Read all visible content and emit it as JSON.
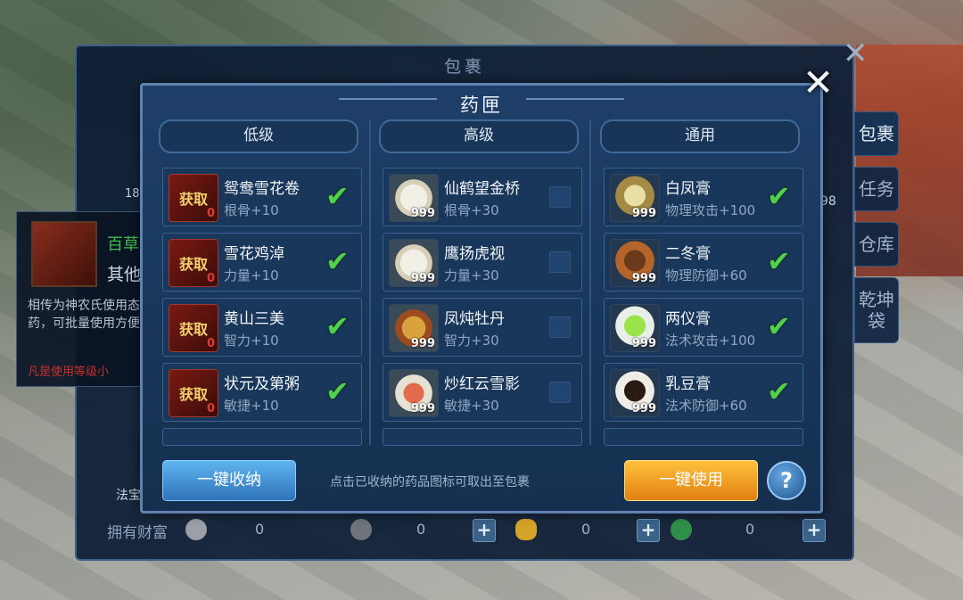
{
  "bag": {
    "title": "包裹",
    "side_tabs": [
      "包裹",
      "任务",
      "仓库",
      "乾坤袋"
    ],
    "stub": {
      "text": "相传为神农氏使用态药，可批量使用方便。",
      "red": "凡是使用等级小",
      "green": "百草",
      "other": "其他",
      "count": "18",
      "magic": "法宝",
      "right_count": "98"
    },
    "wealth": {
      "label": "拥有财富",
      "values": [
        "0",
        "0",
        "0",
        "0"
      ]
    }
  },
  "dialog": {
    "title": "药匣",
    "columns": [
      {
        "header": "低级",
        "items": [
          {
            "name": "鸳鸯雪花卷",
            "effect": "根骨+10",
            "badge": "获取",
            "count": "0",
            "checked": true
          },
          {
            "name": "雪花鸡淖",
            "effect": "力量+10",
            "badge": "获取",
            "count": "0",
            "checked": true
          },
          {
            "name": "黄山三美",
            "effect": "智力+10",
            "badge": "获取",
            "count": "0",
            "checked": true
          },
          {
            "name": "状元及第粥",
            "effect": "敏捷+10",
            "badge": "获取",
            "count": "0",
            "checked": true
          }
        ]
      },
      {
        "header": "高级",
        "items": [
          {
            "name": "仙鹤望金桥",
            "effect": "根骨+30",
            "count": "999",
            "checked": false
          },
          {
            "name": "鹰扬虎视",
            "effect": "力量+30",
            "count": "999",
            "checked": false
          },
          {
            "name": "凤炖牡丹",
            "effect": "智力+30",
            "count": "999",
            "checked": false
          },
          {
            "name": "炒红云雪影",
            "effect": "敏捷+30",
            "count": "999",
            "checked": false
          }
        ]
      },
      {
        "header": "通用",
        "items": [
          {
            "name": "白凤膏",
            "effect": "物理攻击+100",
            "count": "999",
            "checked": true
          },
          {
            "name": "二冬膏",
            "effect": "物理防御+60",
            "count": "999",
            "checked": true
          },
          {
            "name": "两仪膏",
            "effect": "法术攻击+100",
            "count": "999",
            "checked": true
          },
          {
            "name": "乳豆膏",
            "effect": "法术防御+60",
            "count": "999",
            "checked": true
          }
        ]
      }
    ],
    "store_button": "一键收纳",
    "hint": "点击已收纳的药品图标可取出至包裹",
    "use_button": "一键使用",
    "help_button": "?"
  },
  "colors": {
    "accent_blue": "#2f73b9",
    "accent_orange": "#e17f12",
    "check_green": "#52d04a",
    "count_red": "#e23a32"
  }
}
